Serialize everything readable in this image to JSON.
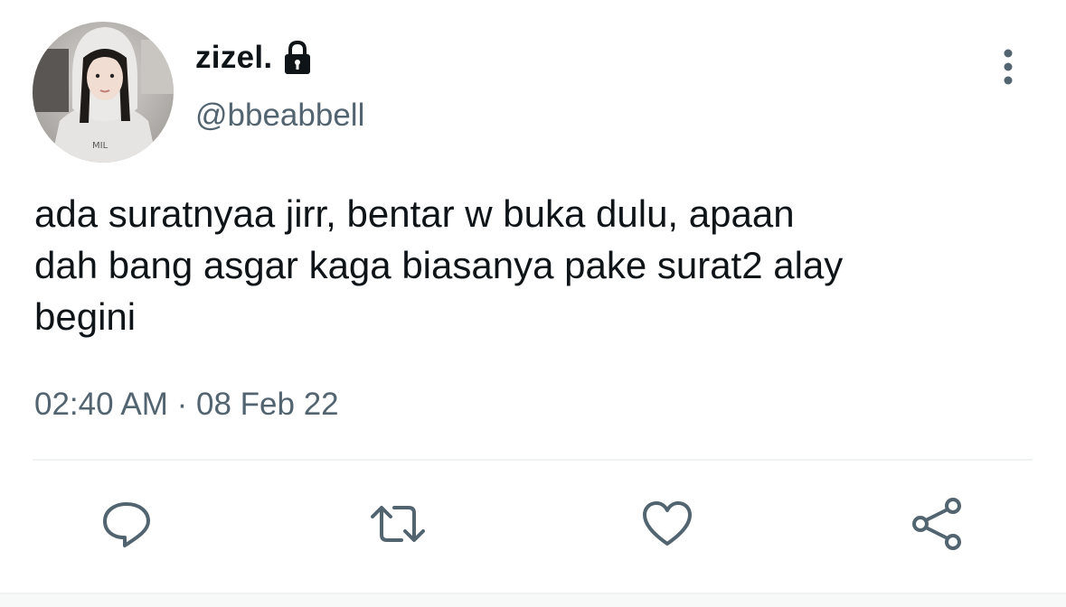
{
  "user": {
    "display_name": "zizel.",
    "handle": "@bbeabbell",
    "avatar_icon": "profile-photo",
    "protected_icon": "lock-icon"
  },
  "tweet": {
    "text": "ada suratnyaa jirr, bentar w buka dulu, apaan\ndah bang asgar kaga biasanya pake surat2 alay\nbegini",
    "time": "02:40 AM",
    "separator": "·",
    "date": "08 Feb 22"
  },
  "actions": [
    {
      "icon": "reply-icon"
    },
    {
      "icon": "retweet-icon"
    },
    {
      "icon": "like-icon"
    },
    {
      "icon": "share-icon"
    }
  ],
  "colors": {
    "primary_text": "#0f1419",
    "secondary_text": "#536471",
    "divider": "#eff3f4"
  }
}
